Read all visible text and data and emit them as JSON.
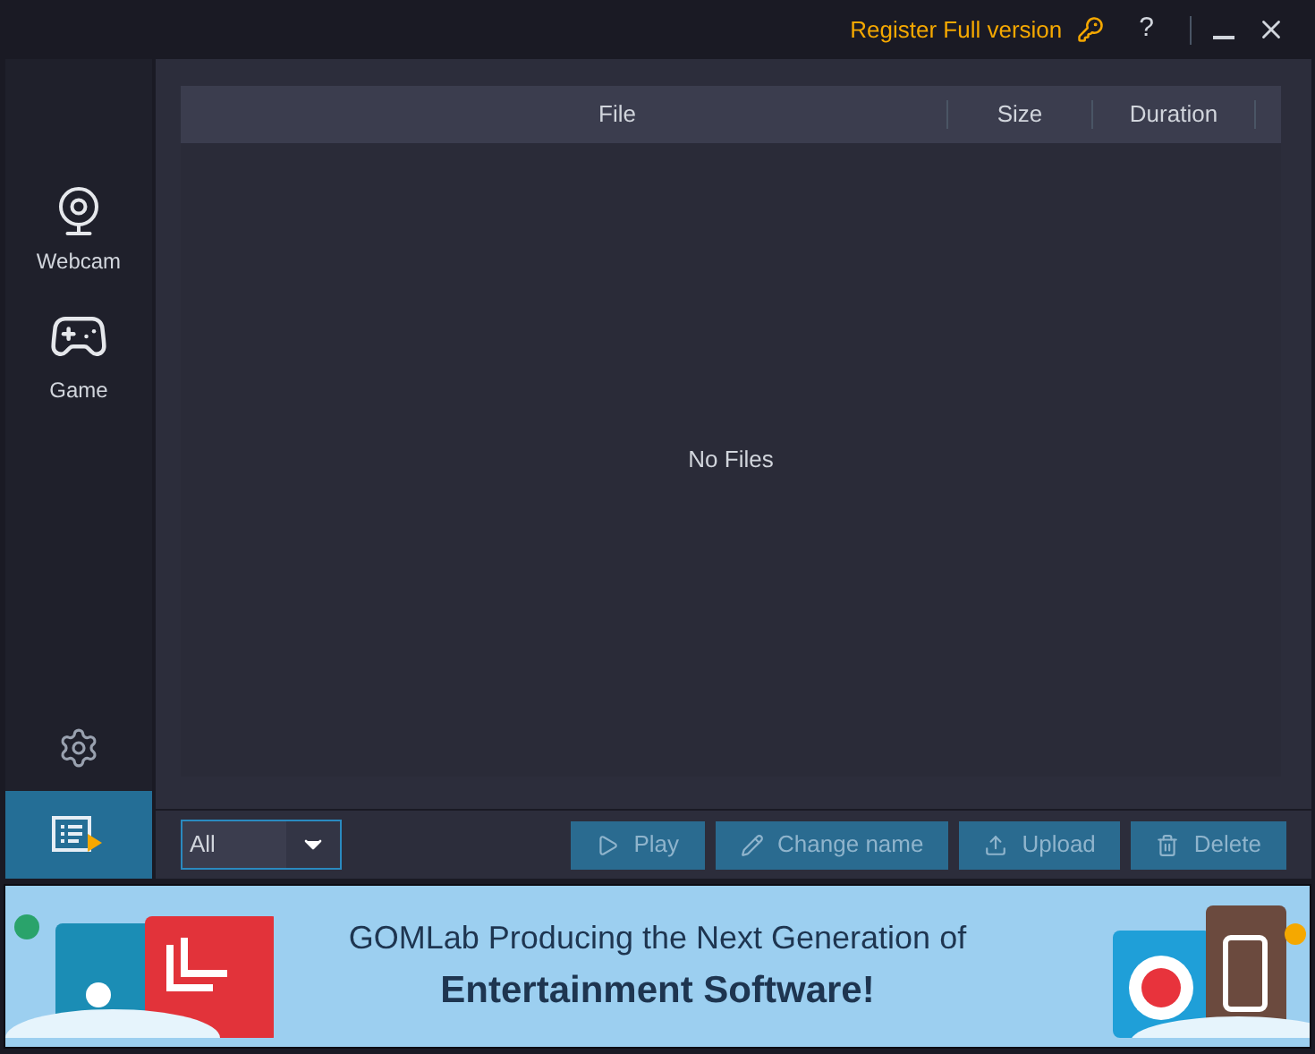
{
  "title_bar": {
    "register": "Register Full version",
    "help": "?"
  },
  "sidebar": {
    "items": [
      {
        "kind": "webcam",
        "label": "Webcam"
      },
      {
        "kind": "game",
        "label": "Game"
      }
    ],
    "list_button_selected": true
  },
  "table": {
    "columns": [
      "File",
      "Size",
      "Duration"
    ],
    "empty_text": "No Files"
  },
  "filter": {
    "value": "All"
  },
  "buttons": [
    {
      "kind": "play",
      "label": "Play"
    },
    {
      "kind": "rename",
      "label": "Change name"
    },
    {
      "kind": "upload",
      "label": "Upload"
    },
    {
      "kind": "delete",
      "label": "Delete"
    }
  ],
  "banner": {
    "line_1": "GOMLab Producing the Next Generation of",
    "line_2": "Entertainment Software!"
  }
}
